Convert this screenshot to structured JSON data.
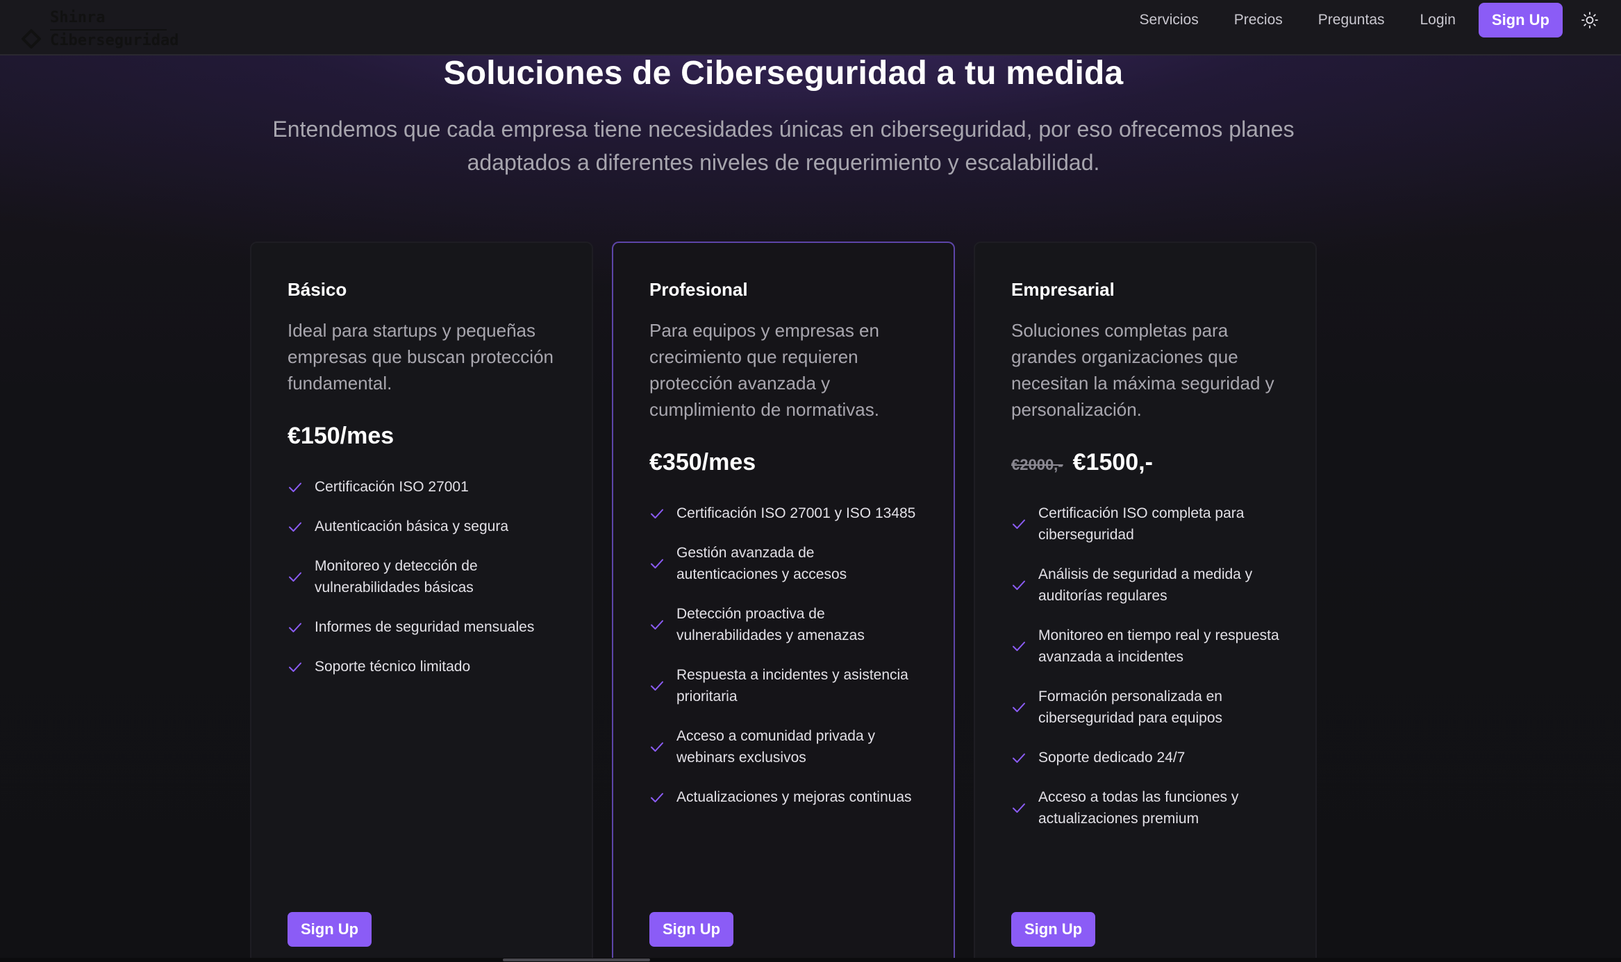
{
  "brand": {
    "line1": "Shinra",
    "line2": "Ciberseguridad",
    "icon": "diamond-logo-icon"
  },
  "nav": {
    "links": [
      "Servicios",
      "Precios",
      "Preguntas",
      "Login"
    ],
    "signup_label": "Sign Up",
    "theme_icon": "sun-icon"
  },
  "hero": {
    "title": "Soluciones de Ciberseguridad a tu medida",
    "subtitle": "Entendemos que cada empresa tiene necesidades únicas en ciberseguridad, por eso ofrecemos planes adaptados a diferentes niveles de requerimiento y escalabilidad."
  },
  "colors": {
    "accent": "#8b5cf6",
    "featured_border": "#5d45a8"
  },
  "plans": [
    {
      "name": "Básico",
      "description": "Ideal para startups y pequeñas empresas que buscan protección fundamental.",
      "price_old": "",
      "price": "€150/mes",
      "features": [
        "Certificación ISO 27001",
        "Autenticación básica y segura",
        "Monitoreo y detección de vulnerabilidades básicas",
        "Informes de seguridad mensuales",
        "Soporte técnico limitado"
      ],
      "cta": "Sign Up"
    },
    {
      "name": "Profesional",
      "description": "Para equipos y empresas en crecimiento que requieren protección avanzada y cumplimiento de normativas.",
      "price_old": "",
      "price": "€350/mes",
      "features": [
        "Certificación ISO 27001 y ISO 13485",
        "Gestión avanzada de autenticaciones y accesos",
        "Detección proactiva de vulnerabilidades y amenazas",
        "Respuesta a incidentes y asistencia prioritaria",
        "Acceso a comunidad privada y webinars exclusivos",
        "Actualizaciones y mejoras continuas"
      ],
      "cta": "Sign Up"
    },
    {
      "name": "Empresarial",
      "description": "Soluciones completas para grandes organizaciones que necesitan la máxima seguridad y personalización.",
      "price_old": "€2000,-",
      "price": "€1500,-",
      "features": [
        "Certificación ISO completa para ciberseguridad",
        "Análisis de seguridad a medida y auditorías regulares",
        "Monitoreo en tiempo real y respuesta avanzada a incidentes",
        "Formación personalizada en ciberseguridad para equipos",
        "Soporte dedicado 24/7",
        "Acceso a todas las funciones y actualizaciones premium"
      ],
      "cta": "Sign Up"
    }
  ]
}
